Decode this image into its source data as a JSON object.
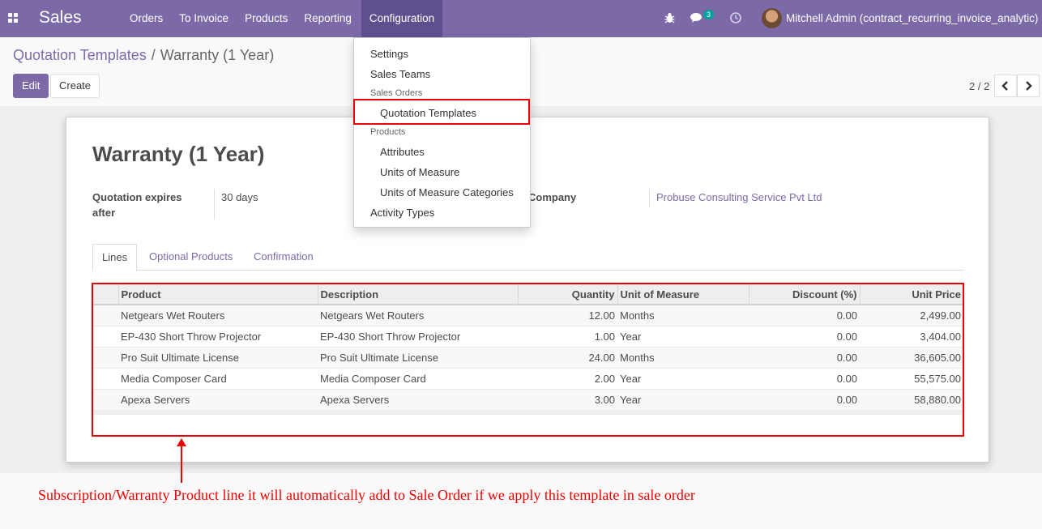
{
  "navbar": {
    "brand": "Sales",
    "menu": [
      "Orders",
      "To Invoice",
      "Products",
      "Reporting",
      "Configuration"
    ],
    "chat_badge": "3",
    "user": "Mitchell Admin (contract_recurring_invoice_analytic)",
    "icons": [
      "apps-icon",
      "bug-icon",
      "chat-icon",
      "clock-icon"
    ],
    "color": "#7c6aa8"
  },
  "breadcrumb": {
    "parent": "Quotation Templates",
    "separator": "/",
    "current": "Warranty (1 Year)"
  },
  "actions": {
    "edit": "Edit",
    "create": "Create"
  },
  "pager": {
    "value": "2 / 2"
  },
  "form": {
    "title": "Warranty (1 Year)",
    "expires_label_1": "Quotation expires",
    "expires_label_2": "after",
    "expires_value": "30 days",
    "company_label": "Company",
    "company_value": "Probuse Consulting Service Pvt Ltd"
  },
  "tabs": [
    "Lines",
    "Optional Products",
    "Confirmation"
  ],
  "table": {
    "columns": [
      "Product",
      "Description",
      "Quantity",
      "Unit of Measure",
      "Discount (%)",
      "Unit Price"
    ],
    "rows": [
      [
        "Netgears Wet Routers",
        "Netgears Wet Routers",
        "12.00",
        "Months",
        "0.00",
        "2,499.00"
      ],
      [
        "EP-430 Short Throw Projector",
        "EP-430 Short Throw Projector",
        "1.00",
        "Year",
        "0.00",
        "3,404.00"
      ],
      [
        "Pro Suit Ultimate License",
        "Pro Suit Ultimate License",
        "24.00",
        "Months",
        "0.00",
        "36,605.00"
      ],
      [
        "Media Composer Card",
        "Media Composer Card",
        "2.00",
        "Year",
        "0.00",
        "55,575.00"
      ],
      [
        "Apexa Servers",
        "Apexa Servers",
        "3.00",
        "Year",
        "0.00",
        "58,880.00"
      ]
    ]
  },
  "dropdown": {
    "settings": "Settings",
    "sales_teams": "Sales Teams",
    "header_sales_orders": "Sales Orders",
    "quotation_templates": "Quotation Templates",
    "header_products": "Products",
    "attributes": "Attributes",
    "uom": "Units of Measure",
    "uom_categories": "Units of Measure Categories",
    "activity_types": "Activity Types"
  },
  "annotation": {
    "text": "Subscription/Warranty Product line it will automatically add to Sale Order if we apply this template in sale order",
    "color": "#e00000"
  }
}
